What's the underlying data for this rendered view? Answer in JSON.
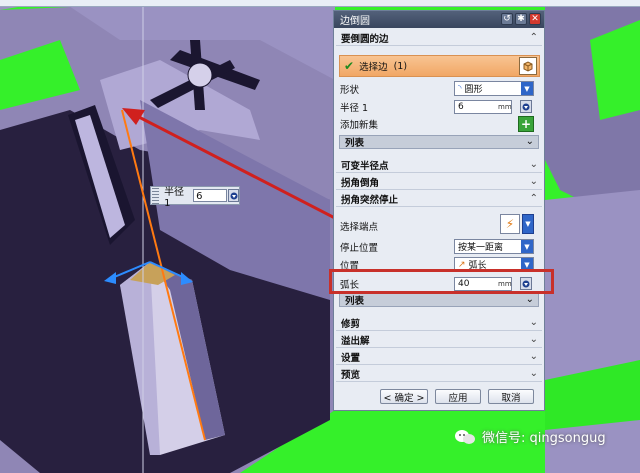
{
  "dialog": {
    "title": "边倒圆",
    "sections": {
      "edges": "要倒圆的边",
      "var_radius": "可变半径点",
      "corner_chamfer": "拐角倒角",
      "corner_stop": "拐角突然停止",
      "trim": "修剪",
      "overflow": "溢出解",
      "settings": "设置",
      "preview": "预览"
    },
    "select_edge": {
      "label": "选择边",
      "count": "(1)"
    },
    "shape": {
      "label": "形状",
      "value": "圆形"
    },
    "radius": {
      "label": "半径 1",
      "value": "6",
      "unit": "mm"
    },
    "add_set": "添加新集",
    "list": "列表",
    "select_end": "选择端点",
    "stop_position": {
      "label": "停止位置",
      "value": "按某一距离"
    },
    "position": {
      "label": "位置",
      "value": "弧长"
    },
    "arc_length": {
      "label": "弧长",
      "value": "40",
      "unit": "mm"
    },
    "buttons": {
      "ok": "< 确定 >",
      "apply": "应用",
      "cancel": "取消"
    }
  },
  "floating": {
    "label": "半径 1",
    "value": "6"
  },
  "watermark": "微信号: qingsongug",
  "colors": {
    "background": "#35f02a",
    "highlight": "#c8302a",
    "title_bar": "#39465e",
    "accent": "#f1a765"
  }
}
